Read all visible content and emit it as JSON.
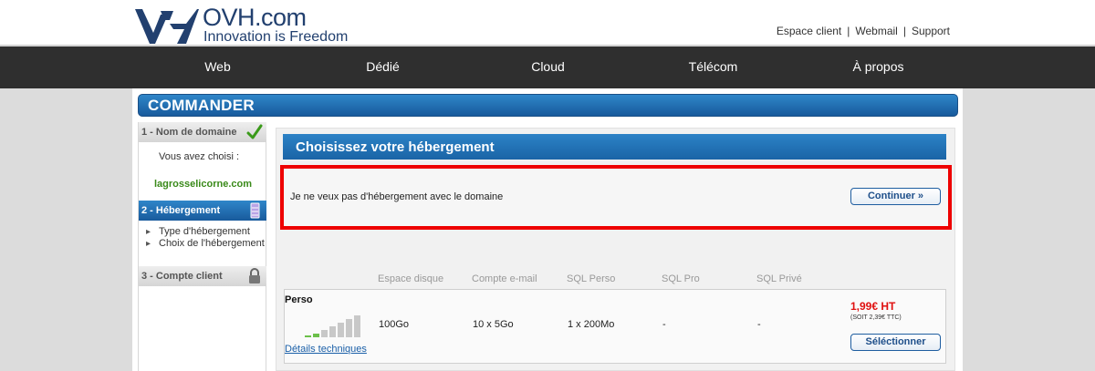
{
  "header": {
    "brand_name": "OVH.com",
    "brand_tagline": "Innovation is Freedom",
    "links": [
      "Espace client",
      "Webmail",
      "Support"
    ],
    "separator": "|"
  },
  "nav": {
    "items": [
      "Web",
      "Dédié",
      "Cloud",
      "Télécom",
      "À propos"
    ]
  },
  "commander": {
    "title": "COMMANDER"
  },
  "sidebar": {
    "step1_label": "1 - Nom de domaine",
    "chosen_label": "Vous avez choisi :",
    "chosen_domain": "lagrosselicorne.com",
    "step2_label": "2 - Hébergement",
    "substep1": "Type d'hébergement",
    "substep2": "Choix de l'hébergement",
    "step3_label": "3 - Compte client"
  },
  "main": {
    "section_title": "Choisissez votre hébergement",
    "nohost_text": "Je ne veux pas d'hébergement avec le domaine",
    "continue_label": "Continuer »",
    "columns": [
      "Espace disque",
      "Compte e-mail",
      "SQL Perso",
      "SQL Pro",
      "SQL Privé"
    ],
    "offer": {
      "name": "Perso",
      "disk": "100Go",
      "email": "10 x 5Go",
      "sql_perso": "1 x 200Mo",
      "sql_pro": "-",
      "sql_prive": "-",
      "details_link": "Détails techniques",
      "price": "1,99€ HT",
      "price_ttc": "(SOIT 2,39€ TTC)",
      "select_label": "Séléctionner"
    }
  },
  "colors": {
    "brand_blue": "#22406f",
    "accent_blue": "#1a64a6",
    "nav_bg": "#2f2f2f",
    "highlight_red": "#ee0000",
    "price_red": "#e01010",
    "domain_green": "#3a8a1a"
  }
}
